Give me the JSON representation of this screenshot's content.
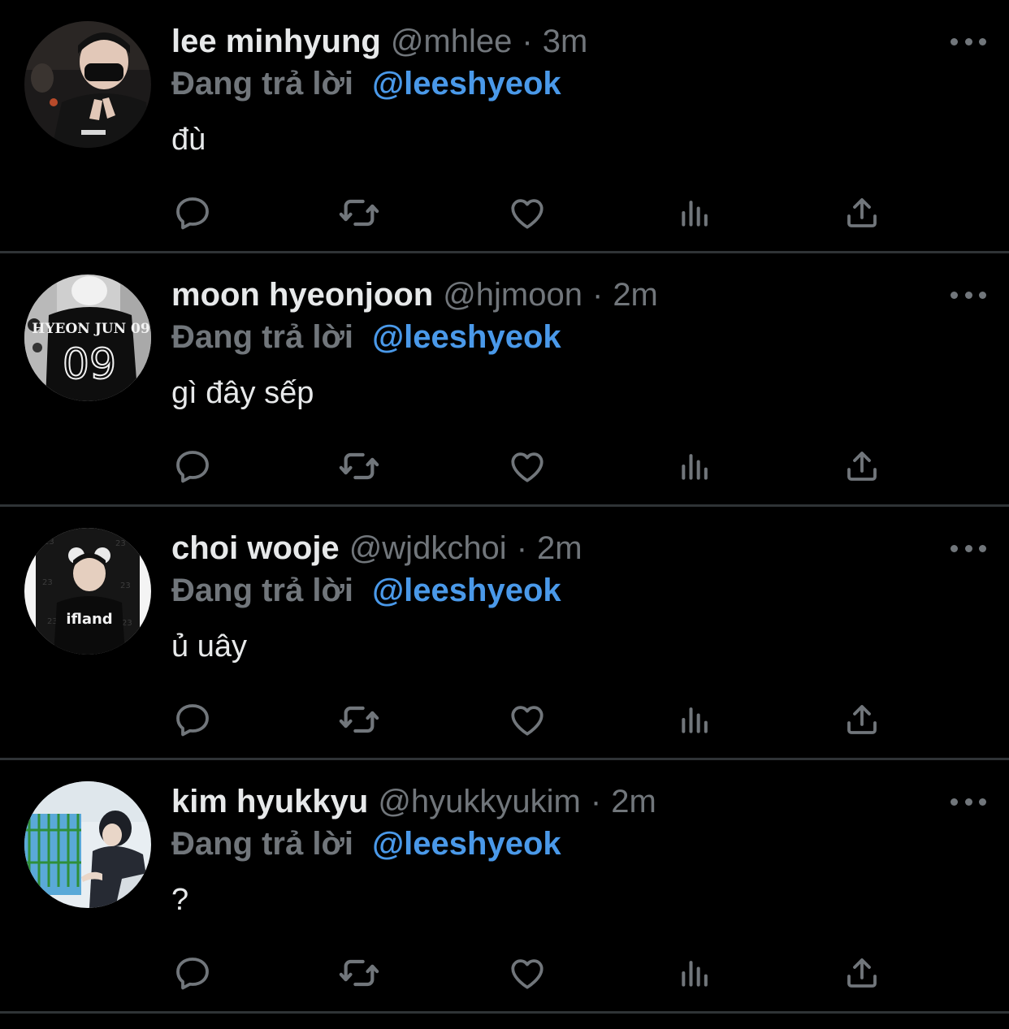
{
  "colors": {
    "background": "#000000",
    "text": "#e7e9ea",
    "secondary": "#71767b",
    "mention": "#4a99e9",
    "divider": "#2f3336"
  },
  "tweets": [
    {
      "display_name": "lee minhyung",
      "handle": "@mhlee",
      "separator": "·",
      "time": "3m",
      "reply_prefix": "Đang trả lời",
      "reply_to": "@leeshyeok",
      "text": "đù"
    },
    {
      "display_name": "moon hyeonjoon",
      "handle": "@hjmoon",
      "separator": "·",
      "time": "2m",
      "reply_prefix": "Đang trả lời",
      "reply_to": "@leeshyeok",
      "text": "gì đây sếp",
      "avatar_text": "HYEON JUN 09"
    },
    {
      "display_name": "choi wooje",
      "handle": "@wjdkchoi",
      "separator": "·",
      "time": "2m",
      "reply_prefix": "Đang trả lời",
      "reply_to": "@leeshyeok",
      "text": "ủ uây",
      "avatar_text": "ifland"
    },
    {
      "display_name": "kim hyukkyu",
      "handle": "@hyukkyukim",
      "separator": "·",
      "time": "2m",
      "reply_prefix": "Đang trả lời",
      "reply_to": "@leeshyeok",
      "text": "?"
    }
  ],
  "action_icons": [
    "reply-icon",
    "retweet-icon",
    "like-icon",
    "analytics-icon",
    "share-icon"
  ],
  "more_icon": "more-options-icon"
}
